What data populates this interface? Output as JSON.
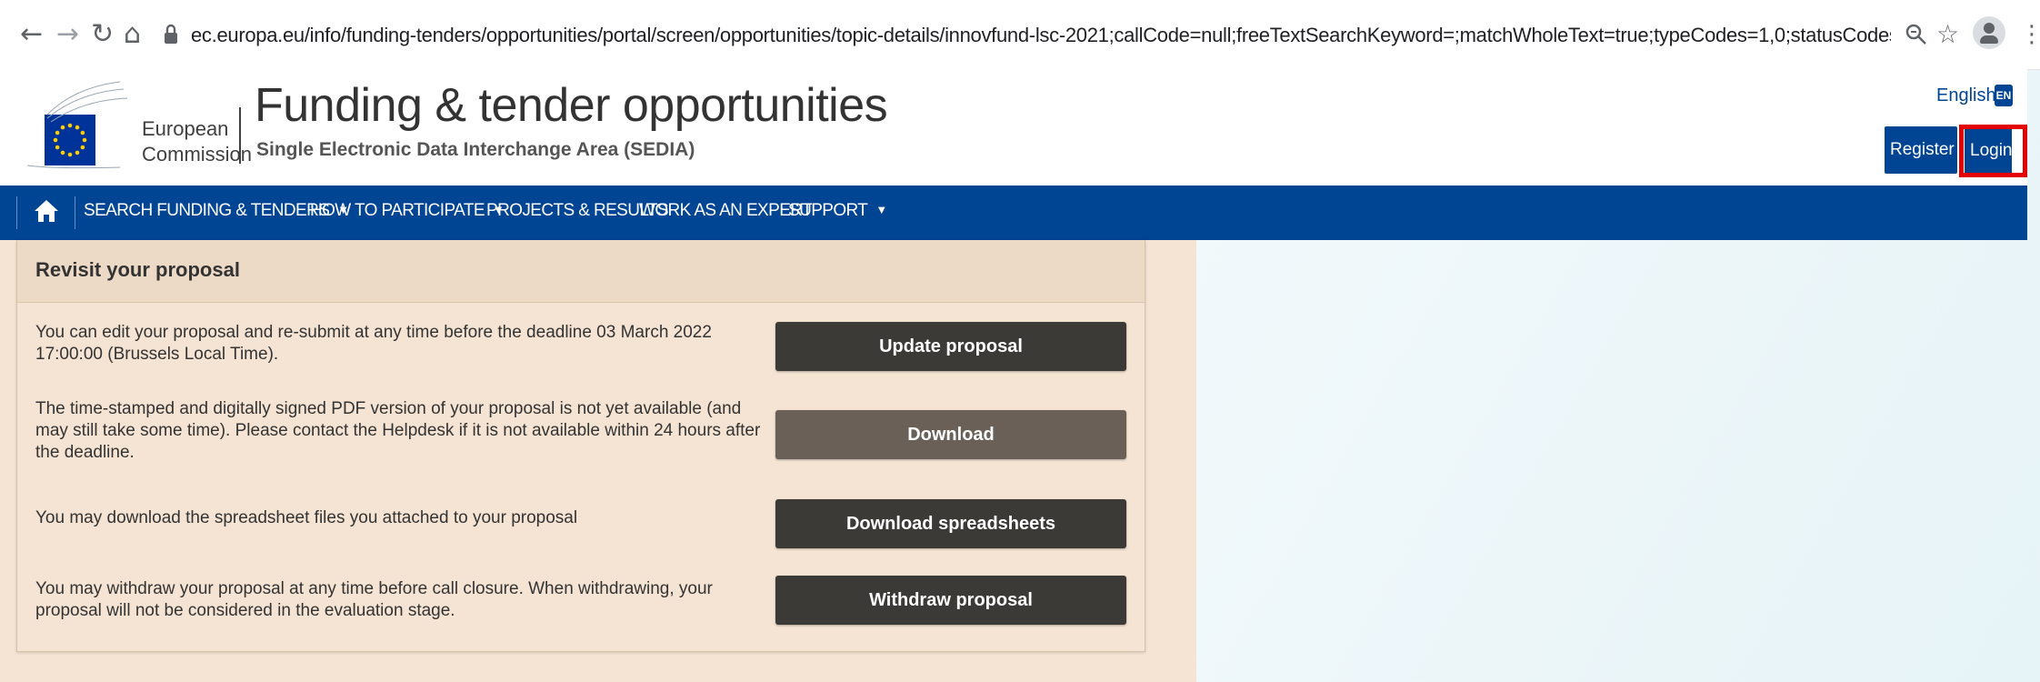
{
  "browser": {
    "url": "ec.europa.eu/info/funding-tenders/opportunities/portal/screen/opportunities/topic-details/innovfund-lsc-2021;callCode=null;freeTextSearchKeyword=;matchWholeText=true;typeCodes=1,0;statusCodes=31094501,31094502,31094503;programmePeriod=202...",
    "icons": [
      "back-arrow-icon",
      "forward-arrow-icon",
      "reload-icon",
      "home-icon",
      "lock-icon",
      "zoom-icon",
      "star-icon",
      "profile-icon",
      "kebab-menu-icon"
    ]
  },
  "header": {
    "org_line1": "European",
    "org_line2": "Commission",
    "portal_title": "Funding & tender opportunities",
    "portal_subtitle": "Single Electronic Data Interchange Area (SEDIA)",
    "language": "English",
    "language_code": "EN",
    "register_label": "Register",
    "login_label": "Login"
  },
  "nav": {
    "items": [
      {
        "label": "SEARCH FUNDING & TENDERS",
        "has_caret": true
      },
      {
        "label": "HOW TO PARTICIPATE",
        "has_caret": true
      },
      {
        "label": "PROJECTS & RESULTS",
        "has_caret": false
      },
      {
        "label": "WORK AS AN EXPERT",
        "has_caret": false
      },
      {
        "label": "SUPPORT",
        "has_caret": true
      }
    ]
  },
  "panel": {
    "title": "Revisit your proposal",
    "rows": [
      {
        "text": "You can edit your proposal and re-submit at any time before the deadline 03 March 2022 17:00:00 (Brussels Local Time).",
        "button": "Update proposal",
        "enabled": true
      },
      {
        "text": "The time-stamped and digitally signed PDF version of your proposal is not yet available (and may still take some time). Please contact the Helpdesk if it is not available within 24 hours after the deadline.",
        "button": "Download",
        "enabled": false
      },
      {
        "text": "You may download the spreadsheet files you attached to your proposal",
        "button": "Download spreadsheets",
        "enabled": true
      },
      {
        "text": "You may withdraw your proposal at any time before call closure. When withdrawing, your proposal will not be considered in the evaluation stage.",
        "button": "Withdraw proposal",
        "enabled": true
      }
    ]
  },
  "colors": {
    "nav_blue": "#004494",
    "panel_bg": "#f5e4d3",
    "button_dark": "#3c3a37",
    "button_disabled": "#6b6058",
    "highlight": "#e50000"
  }
}
